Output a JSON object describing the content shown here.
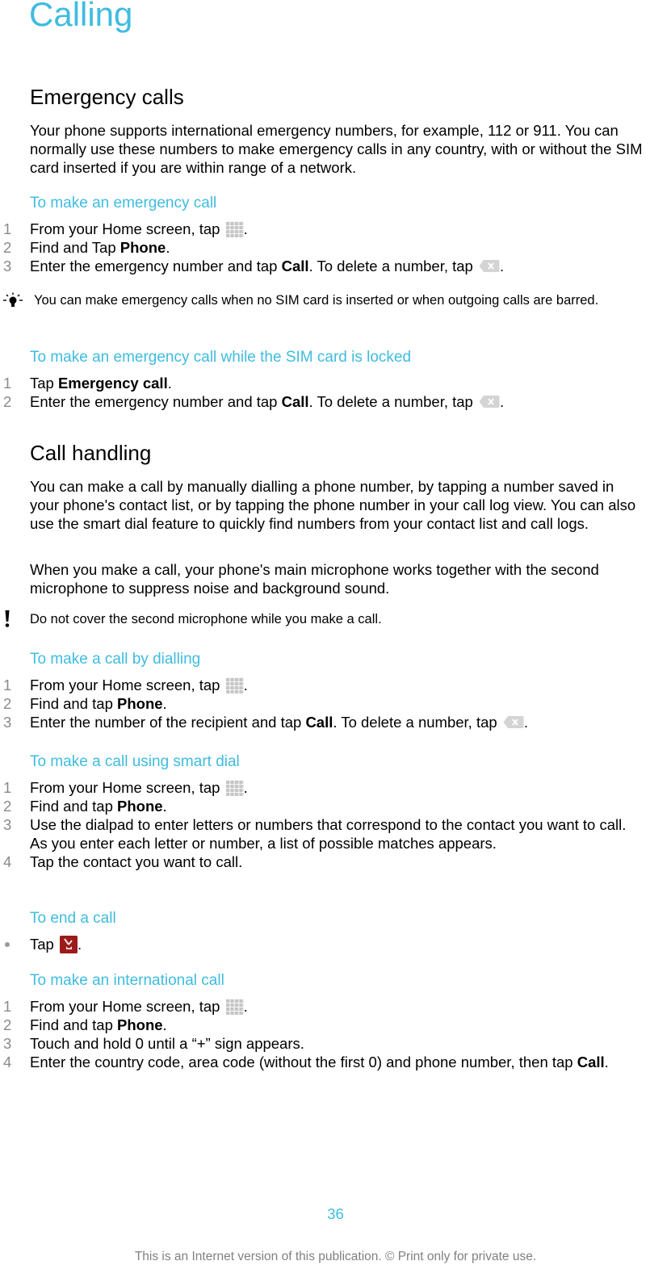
{
  "page_title": "Calling",
  "sections": {
    "emergency": {
      "heading": "Emergency calls",
      "intro": "Your phone supports international emergency numbers, for example, 112 or 911. You can normally use these numbers to make emergency calls in any country, with or without the SIM card inserted if you are within range of a network.",
      "task1": {
        "heading": "To make an emergency call",
        "steps": [
          {
            "num": "1",
            "text": "From your Home screen, tap ",
            "icon": "application-grid-icon",
            "after": "."
          },
          {
            "num": "2",
            "pre": "Find and Tap ",
            "bold": "Phone",
            "after": "."
          },
          {
            "num": "3",
            "pre": "Enter the emergency number and tap ",
            "bold": "Call",
            "mid": ". To delete a number, tap ",
            "icon": "delete-key-icon",
            "after": "."
          }
        ]
      },
      "tip": {
        "icon": "lightbulb-tip-icon",
        "text": "You can make emergency calls when no SIM card is inserted or when outgoing calls are barred."
      },
      "task2": {
        "heading": "To make an emergency call while the SIM card is locked",
        "steps": [
          {
            "num": "1",
            "pre": "Tap ",
            "bold": "Emergency call",
            "after": "."
          },
          {
            "num": "2",
            "pre": "Enter the emergency number and tap ",
            "bold": "Call",
            "mid": ". To delete a number, tap ",
            "icon": "delete-key-icon",
            "after": "."
          }
        ]
      }
    },
    "call_handling": {
      "heading": "Call handling",
      "para1": "You can make a call by manually dialling a phone number, by tapping a number saved in your phone's contact list, or by tapping the phone number in your call log view. You can also use the smart dial feature to quickly find numbers from your contact list and call logs.",
      "para2": "When you make a call, your phone's main microphone works together with the second microphone to suppress noise and background sound.",
      "warning": {
        "icon": "exclamation-warning-icon",
        "text": "Do not cover the second microphone while you make a call."
      },
      "task_dialling": {
        "heading": "To make a call by dialling",
        "steps": [
          {
            "num": "1",
            "text": "From your Home screen, tap ",
            "icon": "application-grid-icon",
            "after": "."
          },
          {
            "num": "2",
            "pre": "Find and tap ",
            "bold": "Phone",
            "after": "."
          },
          {
            "num": "3",
            "pre": "Enter the number of the recipient and tap ",
            "bold": "Call",
            "mid": ". To delete a number, tap ",
            "icon": "delete-key-icon",
            "after": "."
          }
        ]
      },
      "task_smart_dial": {
        "heading": "To make a call using smart dial",
        "steps": [
          {
            "num": "1",
            "text": "From your Home screen, tap ",
            "icon": "application-grid-icon",
            "after": "."
          },
          {
            "num": "2",
            "pre": "Find and tap ",
            "bold": "Phone",
            "after": "."
          },
          {
            "num": "3",
            "text": "Use the dialpad to enter letters or numbers that correspond to the contact you want to call. As you enter each letter or number, a list of possible matches appears."
          },
          {
            "num": "4",
            "text": "Tap the contact you want to call."
          }
        ]
      },
      "task_end": {
        "heading": "To end a call",
        "steps": [
          {
            "num": "•",
            "text": "Tap ",
            "icon": "end-call-icon",
            "after": "."
          }
        ]
      },
      "task_international": {
        "heading": "To make an international call",
        "steps": [
          {
            "num": "1",
            "text": "From your Home screen, tap ",
            "icon": "application-grid-icon",
            "after": "."
          },
          {
            "num": "2",
            "pre": "Find and tap ",
            "bold": "Phone",
            "after": "."
          },
          {
            "num": "3",
            "text": "Touch and hold 0 until a “+” sign appears."
          },
          {
            "num": "4",
            "pre": "Enter the country code, area code (without the first 0) and phone number, then tap ",
            "bold": "Call",
            "after": "."
          }
        ]
      }
    }
  },
  "page_number": "36",
  "footer": "This is an Internet version of this publication. © Print only for private use.",
  "colors": {
    "accent": "#3fbcdf",
    "step_number": "#8a8a8a",
    "footer": "#808080",
    "end_call": "#9b1b1b"
  }
}
